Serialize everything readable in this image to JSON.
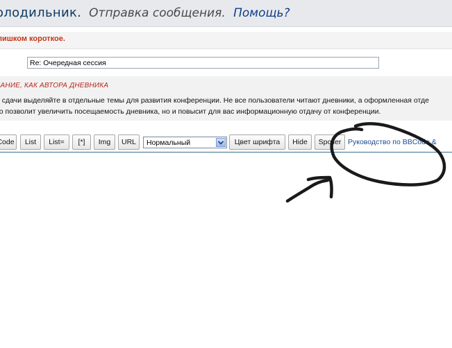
{
  "header": {
    "site_name": "олодильник",
    "separator": ".",
    "page_action": "Отправка сообщения.",
    "help_link": "Помощь?"
  },
  "error": {
    "text": "лишком короткое."
  },
  "subject": {
    "value": "Re: Очередная сессия"
  },
  "notice": {
    "title": "мание, как автора дневника",
    "line1": "е сдачи выделяйте в отдельные темы для развития конференции. Не все пользователи читают дневники, а оформленная отде",
    "line2": "ко позволит увеличить посещаемость дневника, но и повысит для вас информационную отдачу от конференции."
  },
  "toolbar": {
    "buttons": [
      "Code",
      "List",
      "List=",
      "[*]",
      "Img",
      "URL",
      "Цвет шрифта",
      "Hide",
      "Spoiler"
    ],
    "size_select": "Нормальный",
    "guide_link": "Руководство по BBCode",
    "guide_suffix": "&"
  },
  "colors": {
    "header_bg": "#e7e9ec",
    "site_name": "#0e3b63",
    "help_link": "#0f3d8c",
    "error": "#c0391b",
    "notice_title": "#b5271b",
    "link": "#1b4a93",
    "annotation": "#1a1a1a"
  },
  "icons": [
    "chevron-down-icon"
  ]
}
